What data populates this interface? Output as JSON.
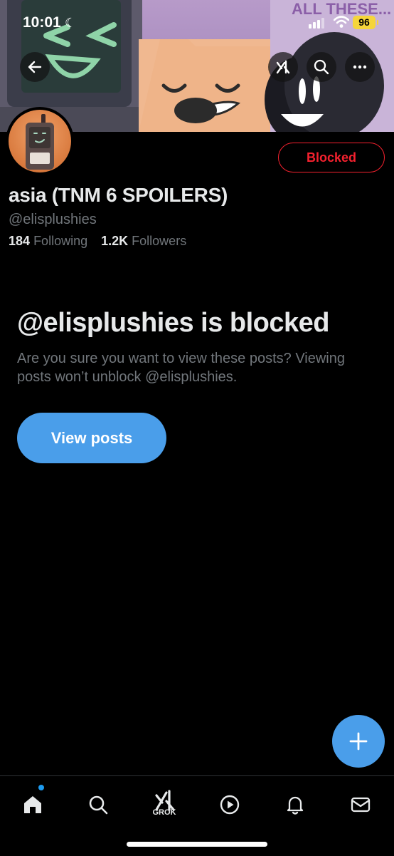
{
  "status_bar": {
    "time": "10:01",
    "battery": "96"
  },
  "banner": {
    "text": "ALL THESE..."
  },
  "profile": {
    "display_name": "asia (TNM 6 SPOILERS)",
    "handle": "@elisplushies",
    "following_count": "184",
    "following_label": "Following",
    "followers_count": "1.2K",
    "followers_label": "Followers",
    "blocked_label": "Blocked"
  },
  "notice": {
    "title": "@elisplushies is blocked",
    "body": "Are you sure you want to view these posts? Viewing posts won’t unblock @elisplushies.",
    "button_label": "View posts"
  },
  "nav": {
    "grok_label": "GROK"
  },
  "colors": {
    "accent": "#4a9eea",
    "danger": "#f4212e",
    "muted": "#71767b",
    "background": "#000000"
  }
}
